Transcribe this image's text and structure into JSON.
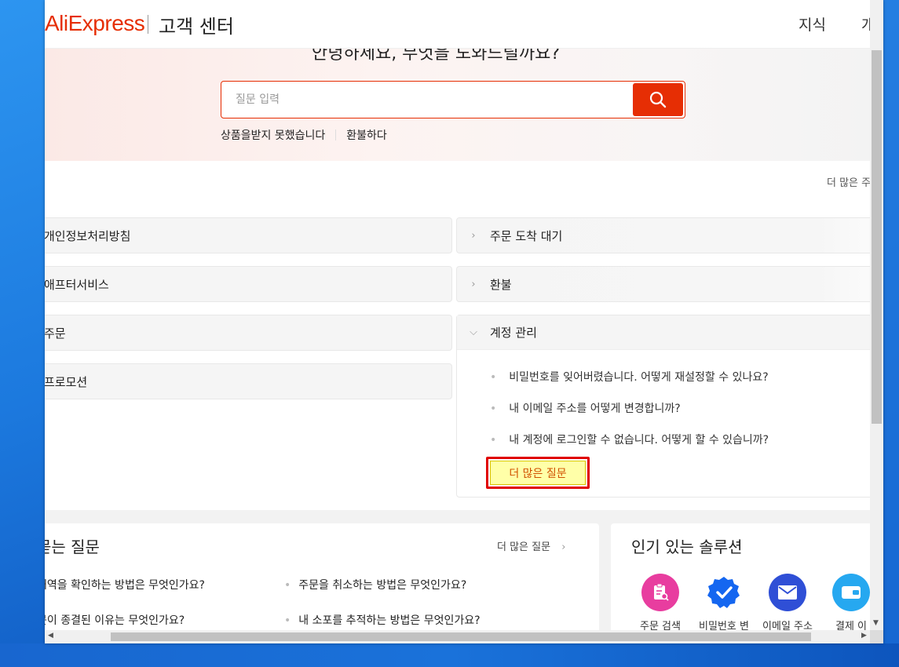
{
  "header": {
    "logo": "AliExpress",
    "title": "고객 센터",
    "nav": [
      "지식",
      "개인"
    ]
  },
  "hero": {
    "greeting": "안녕하세요, 무엇을 도와드릴까요?",
    "search_placeholder": "질문 입력",
    "quick_links": [
      "상품을받지 못했습니다",
      "환불하다"
    ]
  },
  "faq_categories": {
    "more_link": "더 많은 주",
    "left": [
      "개인정보처리방침",
      "애프터서비스",
      "주문",
      "프로모션"
    ],
    "right": [
      "주문 도착 대기",
      "환불"
    ],
    "expanded": {
      "label": "계정 관리",
      "questions": [
        "비밀번호를 잊어버렸습니다. 어떻게 재설정할 수 있나요?",
        "내 이메일 주소를 어떻게 변경합니까?",
        "내 계정에 로그인할 수 없습니다. 어떻게 할 수 있습니까?"
      ],
      "more_button": "더 많은 질문"
    }
  },
  "faq_panel": {
    "title": "묻는 질문",
    "more": "더 많은 질문",
    "questions": [
      "내역을 확인하는 방법은 무엇인가요?",
      "주문을 취소하는 방법은 무엇인가요?",
      "문이 종결된 이유는 무엇인가요?",
      "내 소포를 추적하는 방법은 무엇인가요?"
    ]
  },
  "solutions": {
    "title": "인기 있는 솔루션",
    "items": [
      {
        "label": "주문 검색",
        "icon": "order-search-icon",
        "color": "#e83d9f"
      },
      {
        "label": "비밀번호 변",
        "icon": "password-check-icon",
        "color": "#1466f0"
      },
      {
        "label": "이메일 주소",
        "icon": "email-icon",
        "color": "#2f4fd6"
      },
      {
        "label": "결제 이",
        "icon": "payment-icon",
        "color": "#26a8f0"
      }
    ]
  },
  "colors": {
    "brand": "#e62e04",
    "highlight_border": "#e00000",
    "highlight_fill": "#ffffa8"
  }
}
